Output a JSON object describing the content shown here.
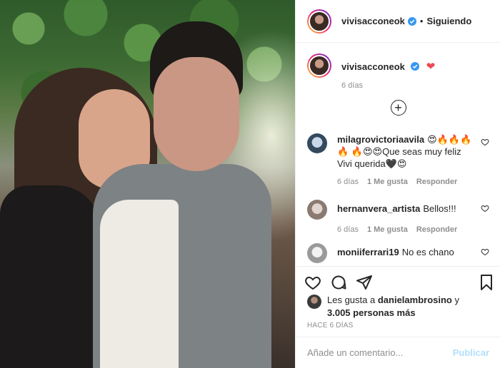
{
  "post": {
    "username": "vivisacconeok",
    "follow_separator": "•",
    "follow_status": "Siguiendo",
    "caption_heart": "❤",
    "caption_time": "6 días",
    "load_more": "+"
  },
  "comments": [
    {
      "username": "milagrovictoriaavila",
      "text": "😍🔥🔥🔥🔥 🔥😍😍Que seas muy feliz Vivi querida🖤😍",
      "time": "6 días",
      "likes": "1 Me gusta",
      "reply": "Responder"
    },
    {
      "username": "hernanvera_artista",
      "text": "Bellos!!!",
      "time": "6 días",
      "likes": "1 Me gusta",
      "reply": "Responder"
    },
    {
      "username": "moniiferrari19",
      "text": "No es chano"
    }
  ],
  "likes": {
    "prefix": "Les gusta a",
    "user": "danielambrosino",
    "joiner": "y",
    "others": "3.005 personas más"
  },
  "time_ago": "HACE 6 DÍAS",
  "add_comment": {
    "placeholder": "Añade un comentario...",
    "publish": "Publicar"
  },
  "colors": {
    "verified": "#3897f0",
    "heart": "#ed4956",
    "publish_disabled": "#b2dffc"
  },
  "icons": [
    "verified-badge-icon",
    "heart-icon",
    "comment-icon",
    "share-icon",
    "bookmark-icon",
    "plus-circle-icon"
  ]
}
